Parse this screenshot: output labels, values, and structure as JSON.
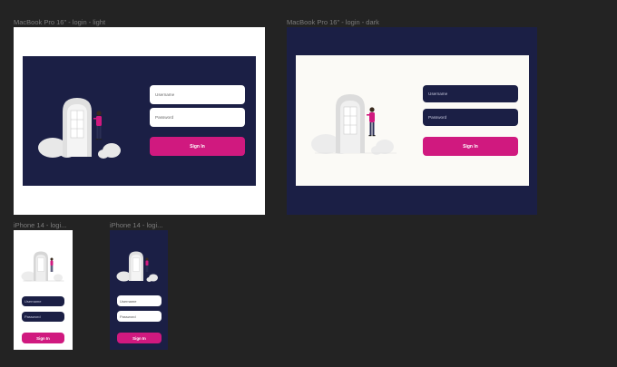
{
  "canvas": {
    "background": "#232323"
  },
  "colors": {
    "navy": "#1b1f45",
    "white": "#ffffff",
    "offwhite": "#fbfaf6",
    "accent": "#d0197f",
    "door": "#dddddd",
    "bush": "#e8e8e8"
  },
  "frames": [
    {
      "label": "MacBook Pro 16\" - login - light",
      "theme": "light"
    },
    {
      "label": "MacBook Pro 16\" - login - dark",
      "theme": "dark"
    },
    {
      "label": "iPhone 14 - logi...",
      "theme": "light"
    },
    {
      "label": "iPhone 14 - logi...",
      "theme": "dark"
    }
  ],
  "login": {
    "username_placeholder": "Username",
    "password_placeholder": "Password",
    "signin_label": "Sign In"
  },
  "icons": [
    "door-illustration-icon",
    "person-icon",
    "bush-icon"
  ]
}
